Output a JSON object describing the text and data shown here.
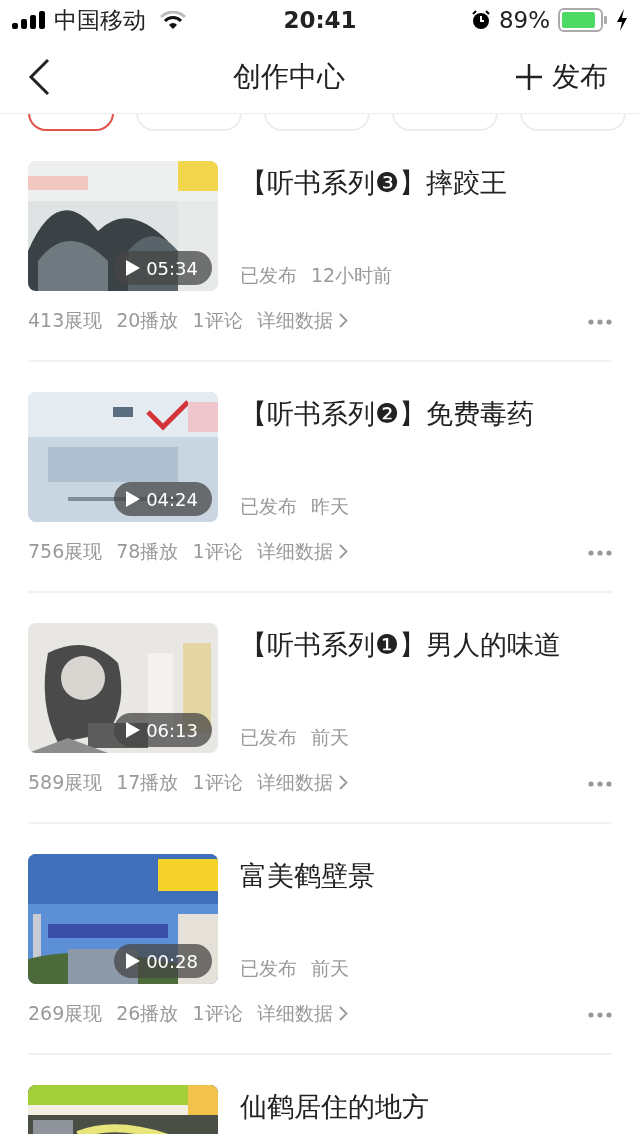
{
  "status_bar": {
    "carrier": "中国移动",
    "time": "20:41",
    "battery": "89%"
  },
  "nav": {
    "title": "创作中心",
    "action": "发布"
  },
  "tabs": [
    {
      "selected": true
    },
    {
      "selected": false
    },
    {
      "selected": false
    },
    {
      "selected": false
    },
    {
      "selected": false
    }
  ],
  "videos": [
    {
      "title": "【听书系列❸】摔跤王",
      "duration": "05:34",
      "status": "已发布",
      "time": "12小时前",
      "stats": [
        "413展现",
        "20播放",
        "1评论"
      ],
      "details": "详细数据"
    },
    {
      "title": "【听书系列❷】免费毒药",
      "duration": "04:24",
      "status": "已发布",
      "time": "昨天",
      "stats": [
        "756展现",
        "78播放",
        "1评论"
      ],
      "details": "详细数据"
    },
    {
      "title": "【听书系列❶】男人的味道",
      "duration": "06:13",
      "status": "已发布",
      "time": "前天",
      "stats": [
        "589展现",
        "17播放",
        "1评论"
      ],
      "details": "详细数据"
    },
    {
      "title": "富美鹤壁景",
      "duration": "00:28",
      "status": "已发布",
      "time": "前天",
      "stats": [
        "269展现",
        "26播放",
        "1评论"
      ],
      "details": "详细数据"
    },
    {
      "title": "仙鹤居住的地方"
    }
  ]
}
